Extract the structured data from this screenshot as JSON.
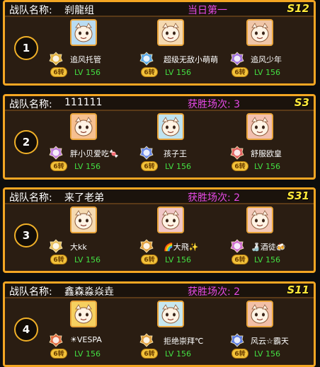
{
  "labels": {
    "team_name_label": "战队名称:",
    "level_prefix": "LV"
  },
  "colors": {
    "panel_border": "#f3a623",
    "panel_bg": "#2a1d12",
    "status": "#e64ae6",
    "season": "#ffe93a",
    "level": "#43e043"
  },
  "teams": [
    {
      "rank": "1",
      "name": "刹龍组",
      "status": "当日第一",
      "season": "S12",
      "members": [
        {
          "name": "追风托管",
          "level": "LV 156",
          "coin": "6转",
          "badge_color": "#e0b040",
          "avatar_color": "#b9dcf2",
          "avatar_icon": "white-bear-avatar-icon"
        },
        {
          "name": "超级无敌小萌萌",
          "level": "LV 156",
          "coin": "6转",
          "badge_color": "#5aa8e8",
          "avatar_color": "#f5d9b0",
          "avatar_icon": "lion-avatar-icon"
        },
        {
          "name": "追风少年",
          "level": "LV 156",
          "coin": "6转",
          "badge_color": "#a070e0",
          "avatar_color": "#f0c6a8",
          "avatar_icon": "horned-avatar-icon"
        }
      ]
    },
    {
      "rank": "2",
      "name": "111111",
      "status": "获胜场次: 3",
      "season": "S3",
      "members": [
        {
          "name": "胖小贝爱吃🍬",
          "level": "LV 156",
          "coin": "6转",
          "badge_color": "#c080e0",
          "avatar_color": "#f6c090",
          "avatar_icon": "cat-avatar-icon"
        },
        {
          "name": "孩子王",
          "level": "LV 156",
          "coin": "6转",
          "badge_color": "#6a88e8",
          "avatar_color": "#bfe3f0",
          "avatar_icon": "ice-wolf-avatar-icon"
        },
        {
          "name": "舒服欧皇",
          "level": "LV 156",
          "coin": "6转",
          "badge_color": "#e06060",
          "avatar_color": "#f2c0b0",
          "avatar_icon": "fox-avatar-icon"
        }
      ]
    },
    {
      "rank": "3",
      "name": "来了老弟",
      "status": "获胜场次: 2",
      "season": "S31",
      "members": [
        {
          "name": "大kk",
          "level": "LV 156",
          "coin": "6转",
          "badge_color": "#e8c060",
          "avatar_color": "#f5d9b0",
          "avatar_icon": "lion-avatar-icon"
        },
        {
          "name": "🌈大飛✨",
          "level": "LV 156",
          "coin": "6转",
          "badge_color": "#e0a040",
          "avatar_color": "#f0c6c6",
          "avatar_icon": "fox-avatar-icon"
        },
        {
          "name": "🍶酒徒🍻",
          "level": "LV 156",
          "coin": "6转",
          "badge_color": "#d070d0",
          "avatar_color": "#f2c8b8",
          "avatar_icon": "horned-avatar-icon"
        }
      ]
    },
    {
      "rank": "4",
      "name": "鑫森淼焱垚",
      "status": "获胜场次: 2",
      "season": "S11",
      "members": [
        {
          "name": "☀VESPA",
          "level": "LV 156",
          "coin": "6转",
          "badge_color": "#e06a40",
          "avatar_color": "#f6d060",
          "avatar_icon": "golden-avatar-icon"
        },
        {
          "name": "拒绝崇拜℃",
          "level": "LV 156",
          "coin": "6转",
          "badge_color": "#e0a040",
          "avatar_color": "#c7e8f0",
          "avatar_icon": "white-fox-avatar-icon"
        },
        {
          "name": "风云☆霸天",
          "level": "LV 156",
          "coin": "6转",
          "badge_color": "#5a7ae0",
          "avatar_color": "#f2c0a8",
          "avatar_icon": "horned-avatar-icon"
        }
      ]
    }
  ]
}
